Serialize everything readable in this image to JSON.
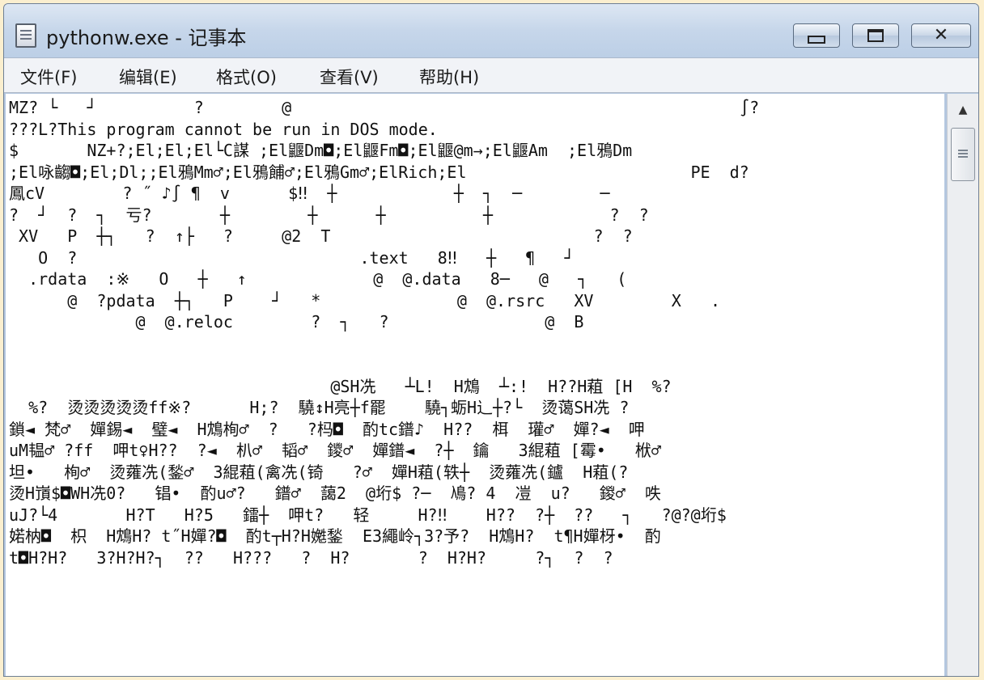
{
  "window": {
    "title": "pythonw.exe - 记事本",
    "controls": {
      "minimize": "minimize-icon",
      "maximize": "maximize-icon",
      "close": "close-icon",
      "close_glyph": "✕"
    }
  },
  "menu": [
    "文件(F)",
    "编辑(E)",
    "格式(O)",
    "查看(V)",
    "帮助(H)"
  ],
  "editor": {
    "lines": [
      "MZ? └   ┘          ?        @                                              ∫?",
      "???L?This program cannot be run in DOS mode.",
      "$       NZ+?;El;El;El└C謀 ;El鼴Dm◘;El鼴Fm◘;El鼴@m→;El鼴Am  ;El鴉Dm",
      ";El咏齺◘;El;Dl;;El鴉Mm♂;El鴉餔♂;El鴉Gm♂;ElRich;El                       PE  d?",
      "鳳cV        ? ˝ ♪∫ ¶  v      $‼  ┼            ┼  ┐  ─        ─",
      "?  ┘  ?  ┐  亏?       ┼        ┼      ┼          ┼            ?  ?",
      " XV   P  ┼┐   ?  ↑├   ?     @2  T                           ?  ?",
      "   O  ?                             .text   8‼   ┼   ¶   ┘",
      "  .rdata  :※   O   ┼   ↑             @  @.data   8─   @   ┐   (",
      "      @  ?pdata  ┼┐   P    ┘   *              @  @.rsrc   XV        X   .",
      "             @  @.reloc        ?  ┐   ?                @  B",
      "",
      "",
      "                                 @SH冼   ┴L!  H鴆  ┴:!  H??H蒩 [H  %?",
      "  %?  烫烫烫烫烫ff※?      H;?  驍↕H亮┼f罷    驍┐蛎H辶┼?└  烫蔼SH冼 ?",
      "鎖◄ 梵♂  嬋錫◄  璧◄  H鴆栒♂  ?   ?杩◘  酌tc鐠♪  H??  栮  瓘♂  嬋?◄  呷",
      "uM韫♂ ?ff  呷t♀H??  ?◄  朳♂  韬♂  鑁♂  嬋鐠◄  ?┼  鑰   3緄蒩 [霉•   栿♂",
      "坦•   栒♂  烫蕹冼(鍫♂  3緄蒩(禽冼(锜   ?♂  嬋H蒩(轶┼  烫蕹冼(鑪  H蒩(?",
      "烫H嵿$◘WH冼0?   锠•  酌u♂?   鐠♂  藹2  @垳$ ?─  鳰? 4  凒  u?   鍐♂  呹",
      "uJ?└4       H?T   H?5   鐳┼  呷t?   轻     H?‼    H??  ?┼  ??   ┐   ?@?@垳$",
      "婼枘◘  枳  H鴆H? t˝H嬋?◘  酌t┬H?H嬔鍫  E3繩岭┐3?予?  H鴆H?  t¶H嬋枒•  酌",
      "t◘H?H?   3?H?H?┐  ??   H???   ?  H?       ?  H?H?     ?┐  ?  ?"
    ]
  },
  "scrollbar": {
    "up_arrow": "▲"
  }
}
